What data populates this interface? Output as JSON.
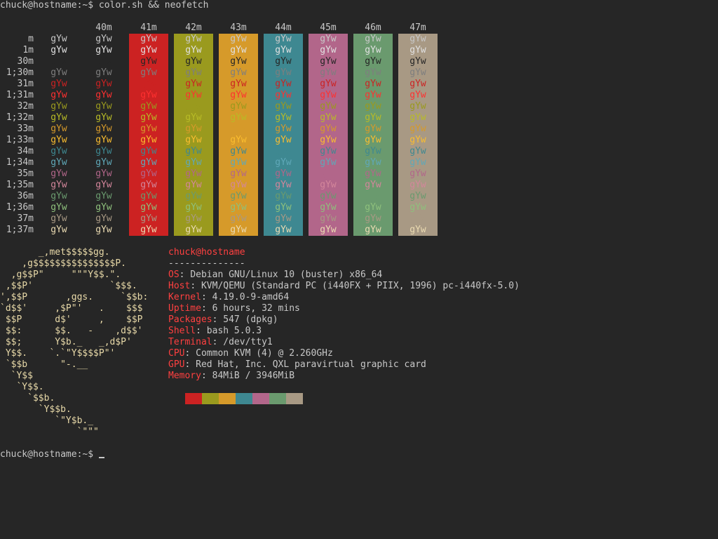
{
  "prompt1": "chuck@hostname:~$ color.sh && neofetch",
  "prompt2": "chuck@hostname:~$ ",
  "sample_text": "gYw",
  "col_headers": [
    "40m",
    "41m",
    "42m",
    "43m",
    "44m",
    "45m",
    "46m",
    "47m"
  ],
  "row_labels": [
    "m",
    "1m",
    "30m",
    "1;30m",
    "31m",
    "1;31m",
    "32m",
    "1;32m",
    "33m",
    "1;33m",
    "34m",
    "1;34m",
    "35m",
    "1;35m",
    "36m",
    "1;36m",
    "37m",
    "1;37m"
  ],
  "colors": {
    "terminal_bg": "#262626",
    "default_fg": "#c8c8c8",
    "palette": [
      "#262626",
      "#cc2222",
      "#9a9a1e",
      "#d69a2a",
      "#3e8891",
      "#b2668a",
      "#6a9a6e",
      "#a89984"
    ],
    "bright": [
      "#7e7e7e",
      "#ff3030",
      "#b8bb26",
      "#fabd2f",
      "#5fa8b8",
      "#d3869b",
      "#8ec07c",
      "#ebdbb2"
    ],
    "fg_row": [
      "#c8c8c8",
      "#e0e0e0",
      "#262626",
      "#7e7e7e",
      "#cc2222",
      "#ff3030",
      "#9a9a1e",
      "#b8bb26",
      "#d69a2a",
      "#fabd2f",
      "#3e8891",
      "#5fa8b8",
      "#b2668a",
      "#d3869b",
      "#6a9a6e",
      "#8ec07c",
      "#a89984",
      "#ebdbb2"
    ],
    "logo": "#e8d9a8",
    "logo_red": "#cc2222",
    "key_red": "#ff4040"
  },
  "neofetch": {
    "user_host": "chuck@hostname",
    "separator": "--------------",
    "info": [
      {
        "key": "OS",
        "value": "Debian GNU/Linux 10 (buster) x86_64"
      },
      {
        "key": "Host",
        "value": "KVM/QEMU (Standard PC (i440FX + PIIX, 1996) pc-i440fx-5.0)"
      },
      {
        "key": "Kernel",
        "value": "4.19.0-9-amd64"
      },
      {
        "key": "Uptime",
        "value": "6 hours, 32 mins"
      },
      {
        "key": "Packages",
        "value": "547 (dpkg)"
      },
      {
        "key": "Shell",
        "value": "bash 5.0.3"
      },
      {
        "key": "Terminal",
        "value": "/dev/tty1"
      },
      {
        "key": "CPU",
        "value": "Common KVM (4) @ 2.260GHz"
      },
      {
        "key": "GPU",
        "value": "Red Hat, Inc. QXL paravirtual graphic card"
      },
      {
        "key": "Memory",
        "value": "84MiB / 3946MiB"
      }
    ],
    "logo_lines": [
      "       _,met$$$$$gg.",
      "    ,g$$$$$$$$$$$$$$$P.",
      "  ,g$$P\"     \"\"\"Y$$.\".",
      " ,$$P'              `$$$.",
      "',$$P       ,ggs.     `$$b:",
      "`d$$'     ,$P\"'   .    $$$",
      " $$P      d$'     ,    $$P",
      " $$:      $$.   -    ,d$$'",
      " $$;      Y$b._   _,d$P'",
      " Y$$.    `.`\"Y$$$$P\"'",
      " `$$b      \"-.__",
      "  `Y$$",
      "   `Y$$.",
      "     `$$b.",
      "       `Y$$b.",
      "          `\"Y$b._",
      "              `\"\"\""
    ]
  }
}
